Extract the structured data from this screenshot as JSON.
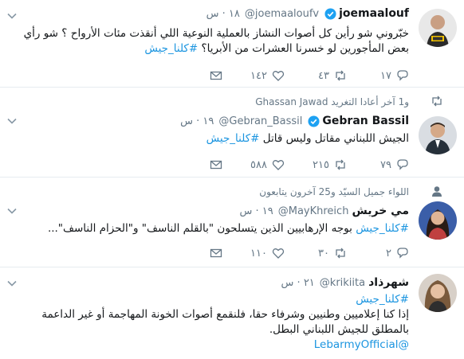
{
  "colors": {
    "accent": "#1b95e0",
    "meta": "#657786",
    "text": "#14171a",
    "divider": "#e6ecf0"
  },
  "tweets": [
    {
      "name": "joemaalouf",
      "handle": "@joemaaloufv",
      "time": "١٨ · س",
      "verified": true,
      "line1": "خبّروني شو رأين كل أصوات النشاز بالعملية النوعية اللي أنقذت مئات الأرواح ؟ شو رأي",
      "line2": "بعض المأجورين لو خسرنا العشرات من الأبريا؟",
      "hashtag": "#كلنا_جيش",
      "replies": "١٧",
      "retweets": "٤٣",
      "likes": "١٤٢",
      "icons": {
        "avatar": "tv-host-avatar",
        "reply": "reply-icon",
        "retweet": "retweet-icon",
        "like": "heart-icon",
        "dm": "mail-icon"
      }
    },
    {
      "context": "Ghassan Jawad و1 آخر أعادا التغريد",
      "name": "Gebran Bassil",
      "handle": "@Gebran_Bassil",
      "time": "١٩ · س",
      "verified": true,
      "line1": "الجيش اللبناني مقاتل وليس قاتل",
      "hashtag": "#كلنا_جيش",
      "replies": "٧٩",
      "retweets": "٢١٥",
      "likes": "٥٨٨"
    },
    {
      "context": "اللواء جميل السيّد و25 آخرون يتابعون",
      "name": "مي خريش",
      "handle": "@MayKhreich",
      "time": "١٩ · س",
      "verified": false,
      "line1": "بوجه الإرهابيين الذين يتسلحون \"بالقلم الناسف\" و\"الحزام الناسف\"...",
      "hashtag": "#كلنا_جيش",
      "replies": "٢",
      "retweets": "٣٠",
      "likes": "١١٠"
    },
    {
      "name": "شهرذاد",
      "handle": "@krikiita",
      "time": "٢١ · س",
      "verified": false,
      "hashtag": "#كلنا_جيش",
      "line1": "إذا كنا إعلاميين وطنيين وشرفاء حقا، فلنقمع أصوات الخونة المهاجمة أو غير الداعمة",
      "line2": "بالمطلق للجيش اللبناني البطل.",
      "mention": "@LebarmyOfficial"
    }
  ]
}
